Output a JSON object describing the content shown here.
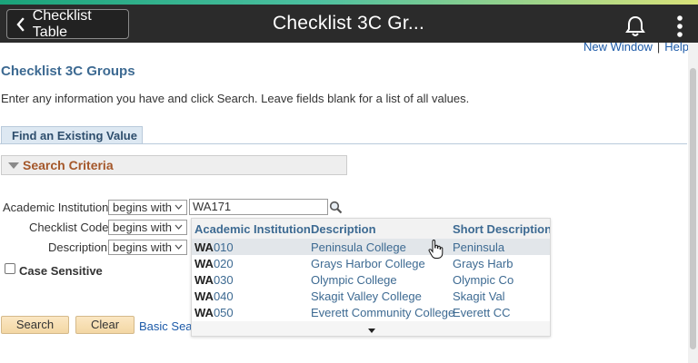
{
  "header": {
    "back_label": "Checklist Table",
    "title": "Checklist 3C Gr...",
    "icons": {
      "bell": "bell-icon",
      "menu": "kebab-menu-icon",
      "back": "chevron-left-icon"
    }
  },
  "links": {
    "new_window": "New Window",
    "separator": "|",
    "help": "Help"
  },
  "page": {
    "title": "Checklist 3C Groups",
    "instructions": "Enter any information you have and click Search. Leave fields blank for a list of all values."
  },
  "tab": {
    "label": "Find an Existing Value"
  },
  "search_criteria": {
    "label": "Search Criteria"
  },
  "fields": [
    {
      "label": "Academic Institution",
      "operator": "begins with",
      "value": "WA171"
    },
    {
      "label": "Checklist Code",
      "operator": "begins with",
      "value": ""
    },
    {
      "label": "Description",
      "operator": "begins with",
      "value": ""
    }
  ],
  "case_sensitive": {
    "label": "Case Sensitive",
    "checked": false
  },
  "buttons": {
    "search": "Search",
    "clear": "Clear",
    "basic_search": "Basic Sea"
  },
  "dropdown": {
    "columns": [
      "Academic Institution",
      "Description",
      "Short Description"
    ],
    "rows": [
      {
        "prefix": "WA",
        "code": "010",
        "description": "Peninsula College",
        "short": "Peninsula"
      },
      {
        "prefix": "WA",
        "code": "020",
        "description": "Grays Harbor College",
        "short": "Grays Harb"
      },
      {
        "prefix": "WA",
        "code": "030",
        "description": "Olympic College",
        "short": "Olympic Co"
      },
      {
        "prefix": "WA",
        "code": "040",
        "description": "Skagit Valley College",
        "short": "Skagit Val"
      },
      {
        "prefix": "WA",
        "code": "050",
        "description": "Everett Community College",
        "short": "Everett CC"
      }
    ]
  },
  "colors": {
    "header_bg": "#2b2b2b",
    "title_blue": "#3d6a92",
    "criteria_orange": "#a4572a",
    "button_bg": "#f3d7a4"
  }
}
